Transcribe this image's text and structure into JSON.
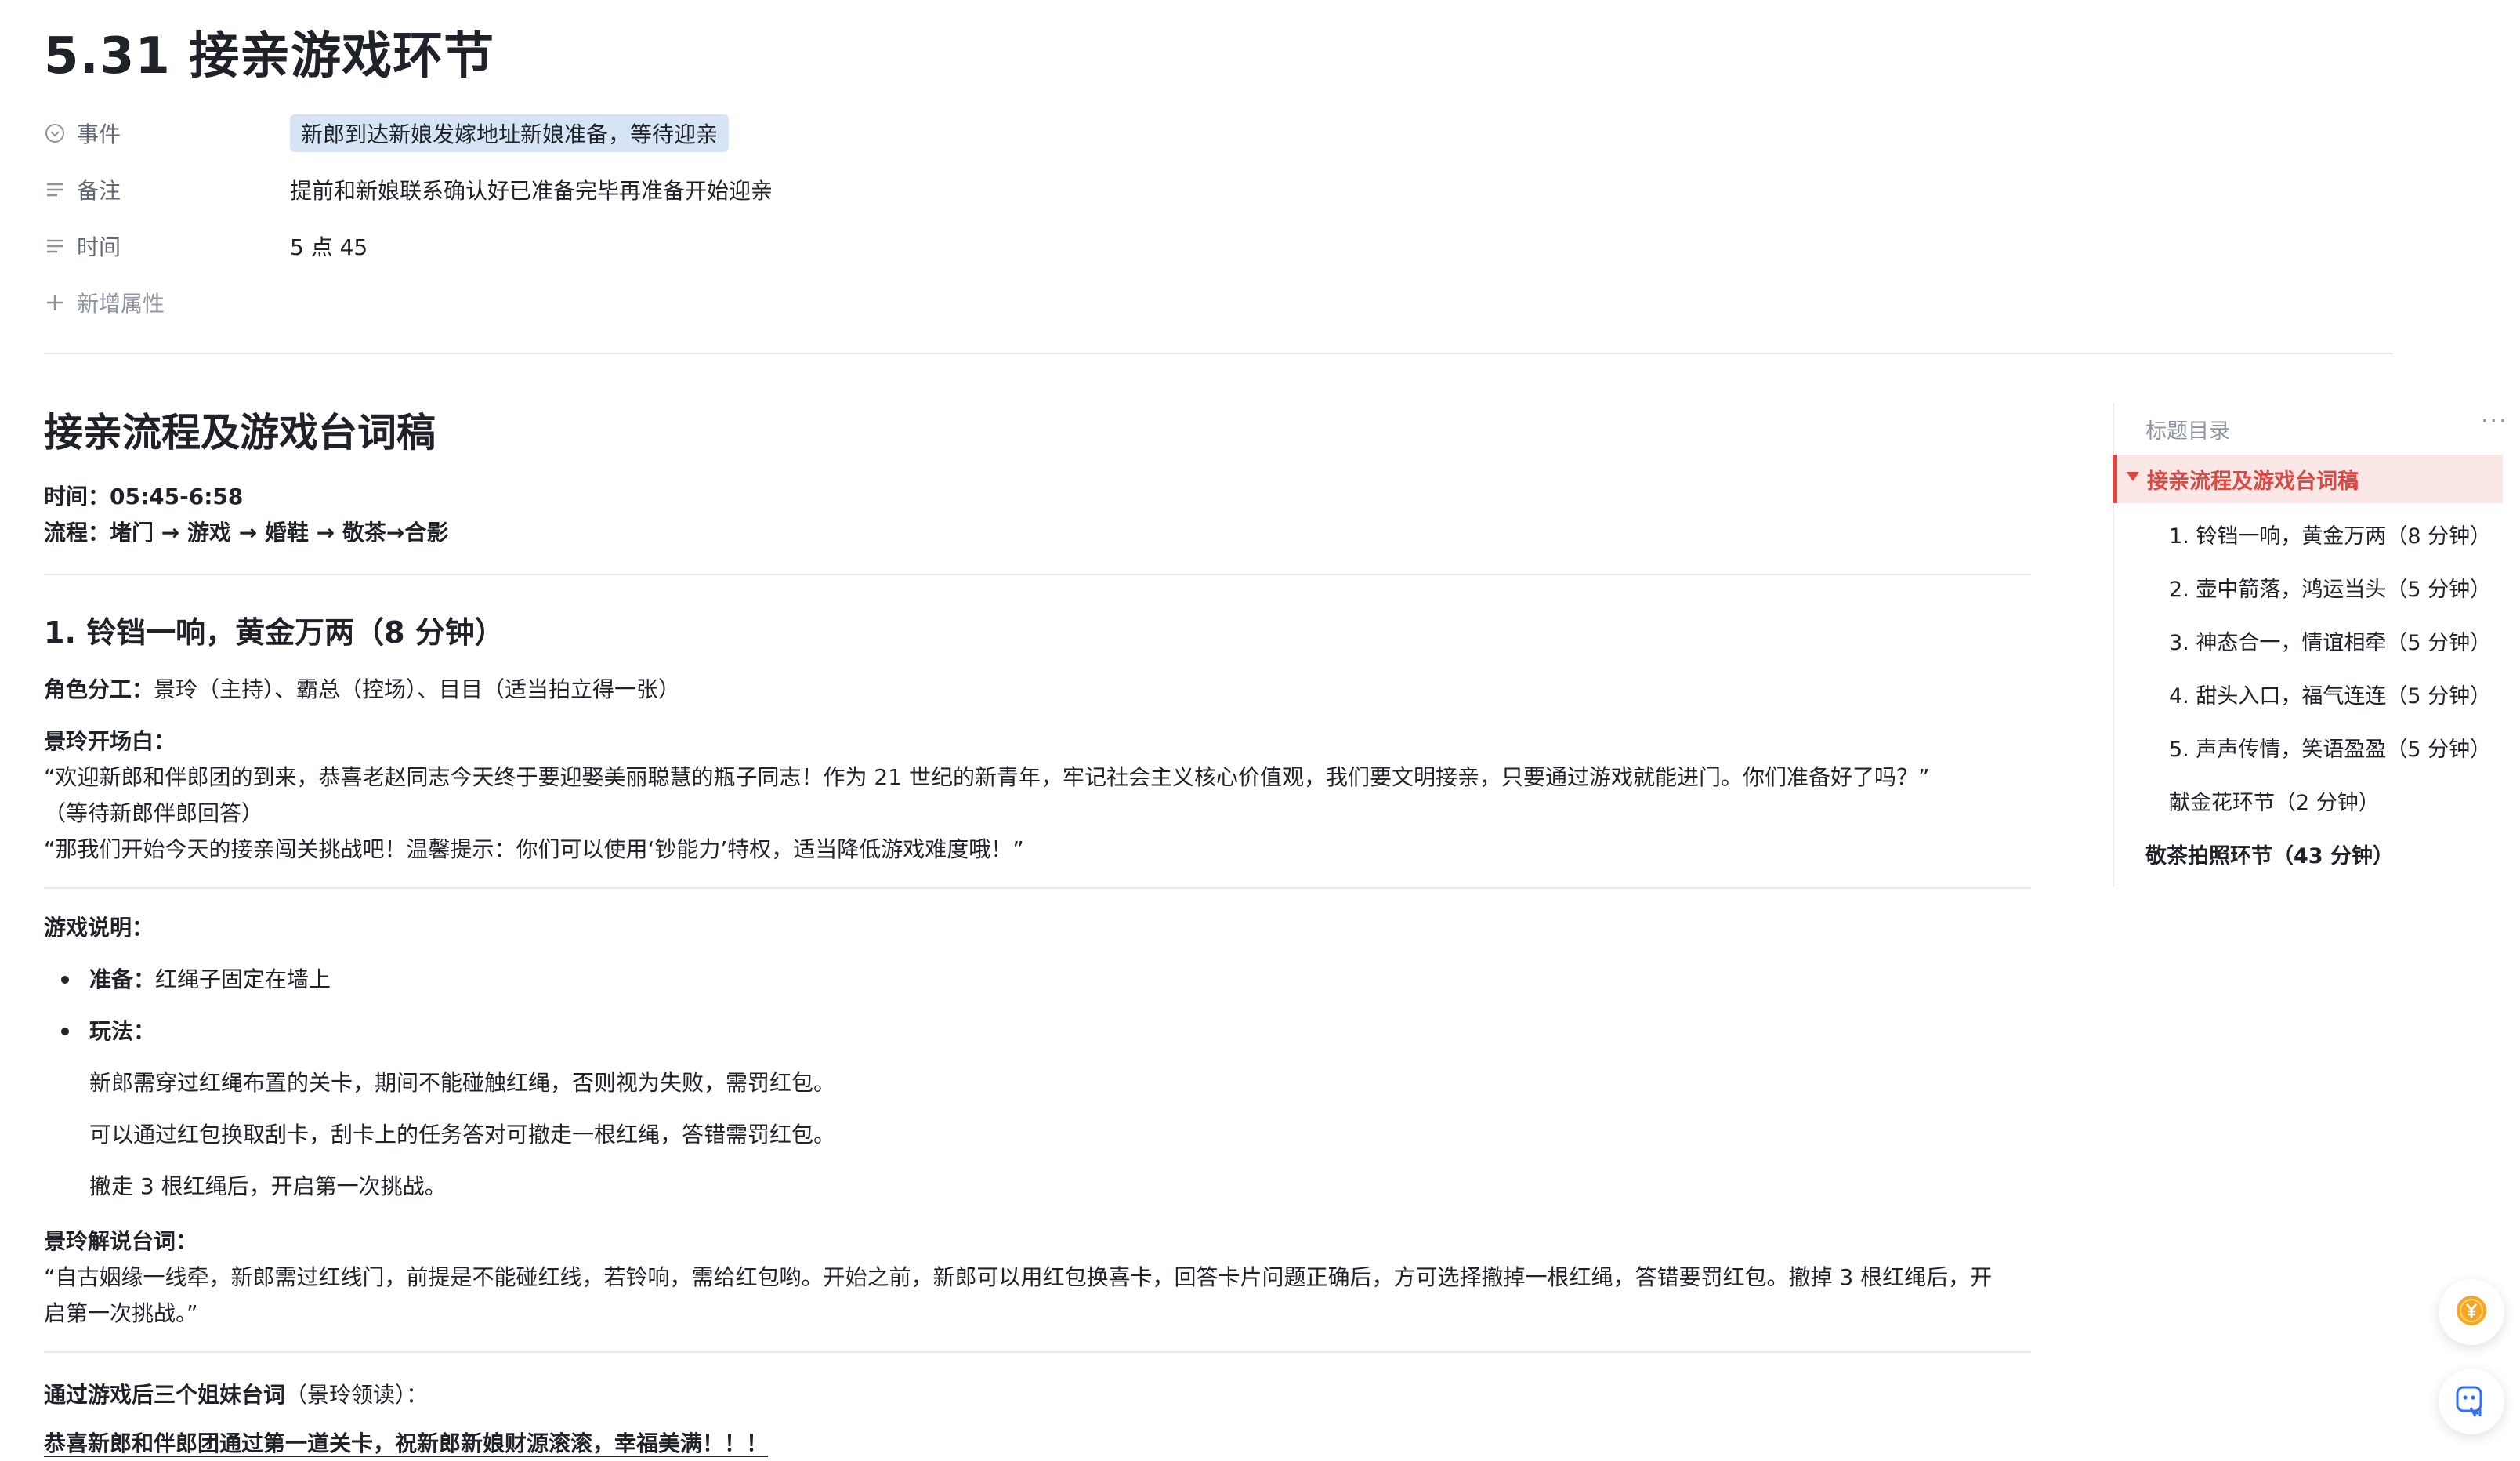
{
  "page": {
    "title": "5.31 接亲游戏环节"
  },
  "properties": [
    {
      "label": "事件",
      "value": "新郎到达新娘发嫁地址新娘准备，等待迎亲",
      "icon": "select-circle-icon"
    },
    {
      "label": "备注",
      "value": "提前和新娘联系确认好已准备完毕再准备开始迎亲",
      "icon": "text-lines-icon"
    },
    {
      "label": "时间",
      "value": "5 点 45",
      "icon": "text-lines-icon"
    }
  ],
  "add_property_label": "新增属性",
  "doc": {
    "heading": "接亲流程及游戏台词稿",
    "time_line": "时间：05:45-6:58",
    "flow_line": "流程：堵门 → 游戏 → 婚鞋 → 敬茶→合影",
    "section1_heading": "1. 铃铛一响，黄金万两（8 分钟）",
    "roles_label": "角色分工：",
    "roles_value": "景玲（主持）、霸总（控场）、目目（适当拍立得一张）",
    "opening_label": "景玲开场白：",
    "opening_line1": "“欢迎新郎和伴郎团的到来，恭喜老赵同志今天终于要迎娶美丽聪慧的瓶子同志！作为 21 世纪的新青年，牢记社会主义核心价值观，我们要文明接亲，只要通过游戏就能进门。你们准备好了吗？”",
    "opening_line2": "（等待新郎伴郎回答）",
    "opening_line3": "“那我们开始今天的接亲闯关挑战吧！温馨提示：你们可以使用‘钞能力’特权，适当降低游戏难度哦！”",
    "game_label": "游戏说明：",
    "prep_label": "准备：",
    "prep_value": "红绳子固定在墙上",
    "play_label": "玩法：",
    "play_line1": "新郎需穿过红绳布置的关卡，期间不能碰触红绳，否则视为失败，需罚红包。",
    "play_line2": "可以通过红包换取刮卡，刮卡上的任务答对可撤走一根红绳，答错需罚红包。",
    "play_line3": "撤走 3 根红绳后，开启第一次挑战。",
    "commentary_label": "景玲解说台词：",
    "commentary_line1": "“自古姻缘一线牵，新郎需过红线门，前提是不能碰红线，若铃响，需给红包哟。开始之前，新郎可以用红包换喜卡，回答卡片问题正确后，方可选择撤掉一根红绳，答错要罚红包。撤掉 3 根红绳后，开",
    "commentary_line2": "启第一次挑战。”",
    "sisters_label": "通过游戏后三个姐妹台词",
    "sisters_note": "（景玲领读）：",
    "sisters_line": "恭喜新郎和伴郎团通过第一道关卡，祝新郎新娘财源滚滚，幸福美满！！！"
  },
  "toc": {
    "title": "标题目录",
    "active": "接亲流程及游戏台词稿",
    "items": [
      "1. 铃铛一响，黄金万两（8 分钟）",
      "2. 壶中箭落，鸿运当头（5 分钟）",
      "3. 神态合一，情谊相牵（5 分钟）",
      "4. 甜头入口，福气连连（5 分钟）",
      "5. 声声传情，笑语盈盈（5 分钟）",
      "献金花环节（2 分钟）"
    ],
    "last": "敬茶拍照环节（43 分钟）"
  },
  "colors": {
    "accent_red": "#d94a44",
    "tag_blue": "#d6e4f6",
    "coin_orange": "#f5a623"
  }
}
